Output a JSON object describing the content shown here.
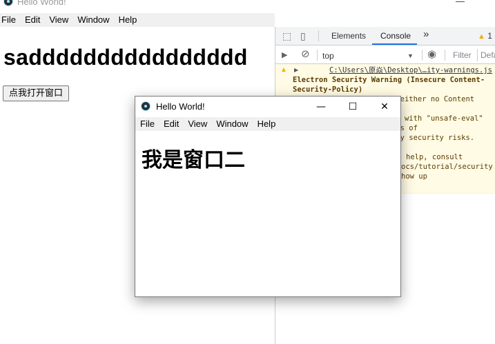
{
  "main_window": {
    "title": "Hello World!",
    "menu": [
      "File",
      "Edit",
      "View",
      "Window",
      "Help"
    ],
    "heading": "sadddddddddddddddd",
    "open_button_label": "点我打开窗口"
  },
  "devtools": {
    "tabs": [
      "Elements",
      "Console"
    ],
    "active_tab": "Console",
    "more_tabs_icon": "»",
    "warning_count": "1",
    "context": "top",
    "filter_placeholder": "Filter",
    "levels_label": "Defa",
    "message": {
      "source_link": "C:\\Users\\原焱\\Desktop\\…ity-warnings.js",
      "lines": [
        "Electron Security Warning (Insecure Content-",
        "Security-Policy)",
        "s either no Content",
        "cy with \"unsafe-eval\"",
        "ers of",
        "ary security risks.",
        "help, consult",
        "ocs/tutorial/security",
        "how up"
      ]
    }
  },
  "second_window": {
    "title": "Hello World!",
    "menu": [
      "File",
      "Edit",
      "View",
      "Window",
      "Help"
    ],
    "heading": "我是窗口二",
    "controls": {
      "minimize": "—",
      "maximize": "☐",
      "close": "✕"
    }
  },
  "icons": {
    "inspect": "⬚",
    "device": "▯",
    "sidebar": "▶",
    "clear": "⊘",
    "eye": "◉",
    "warning": "▲",
    "caret": "▶",
    "dropdown": "▼"
  },
  "colors": {
    "warning_bg": "#fffbe5",
    "warning_text": "#5c3c00",
    "warning_icon": "#f9ab00",
    "active_tab_underline": "#1a73e8"
  }
}
